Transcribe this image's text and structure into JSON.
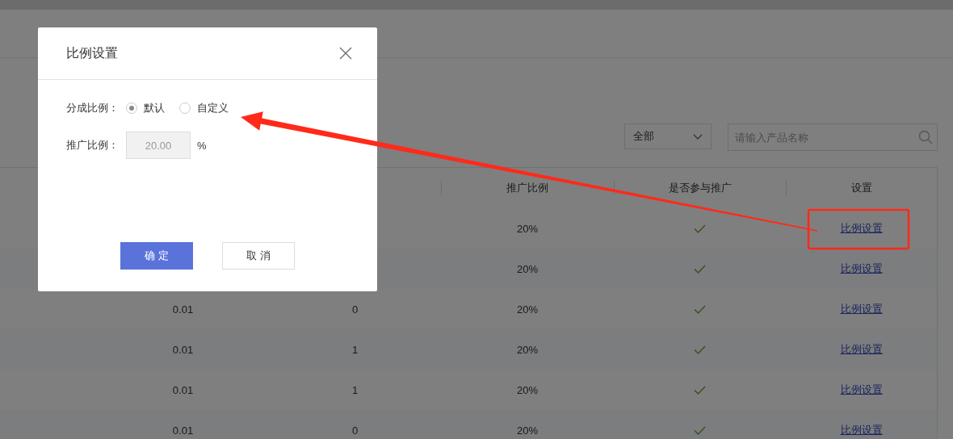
{
  "filters": {
    "category_select": {
      "value": "全部"
    },
    "search": {
      "placeholder": "请输入产品名称"
    }
  },
  "table": {
    "columns": [
      {
        "label": "推广比例"
      },
      {
        "label": "是否参与推广"
      },
      {
        "label": "设置"
      }
    ],
    "rows": [
      {
        "ratio": "20%",
        "promoted": true,
        "action": "比例设置"
      },
      {
        "ratio": "20%",
        "promoted": true,
        "action": "比例设置"
      },
      {
        "column_2": "0.01",
        "column_3": "0",
        "ratio": "20%",
        "promoted": true,
        "action": "比例设置"
      },
      {
        "column_2": "0.01",
        "column_3": "1",
        "ratio": "20%",
        "promoted": true,
        "action": "比例设置"
      },
      {
        "column_2": "0.01",
        "column_3": "1",
        "ratio": "20%",
        "promoted": true,
        "action": "比例设置"
      },
      {
        "column_2": "0.01",
        "column_3": "0",
        "ratio": "20%",
        "promoted": true,
        "action": "比例设置"
      }
    ]
  },
  "dialog": {
    "title": "比例设置",
    "share_label": "分成比例：",
    "share_options": [
      {
        "label": "默认",
        "selected": true
      },
      {
        "label": "自定义",
        "selected": false
      }
    ],
    "promo_label": "推广比例：",
    "promo_value": "20.00",
    "promo_disabled": true,
    "promo_unit": "%",
    "buttons": [
      {
        "label": "确 定",
        "kind": "primary"
      },
      {
        "label": "取 消",
        "kind": "default"
      }
    ]
  }
}
